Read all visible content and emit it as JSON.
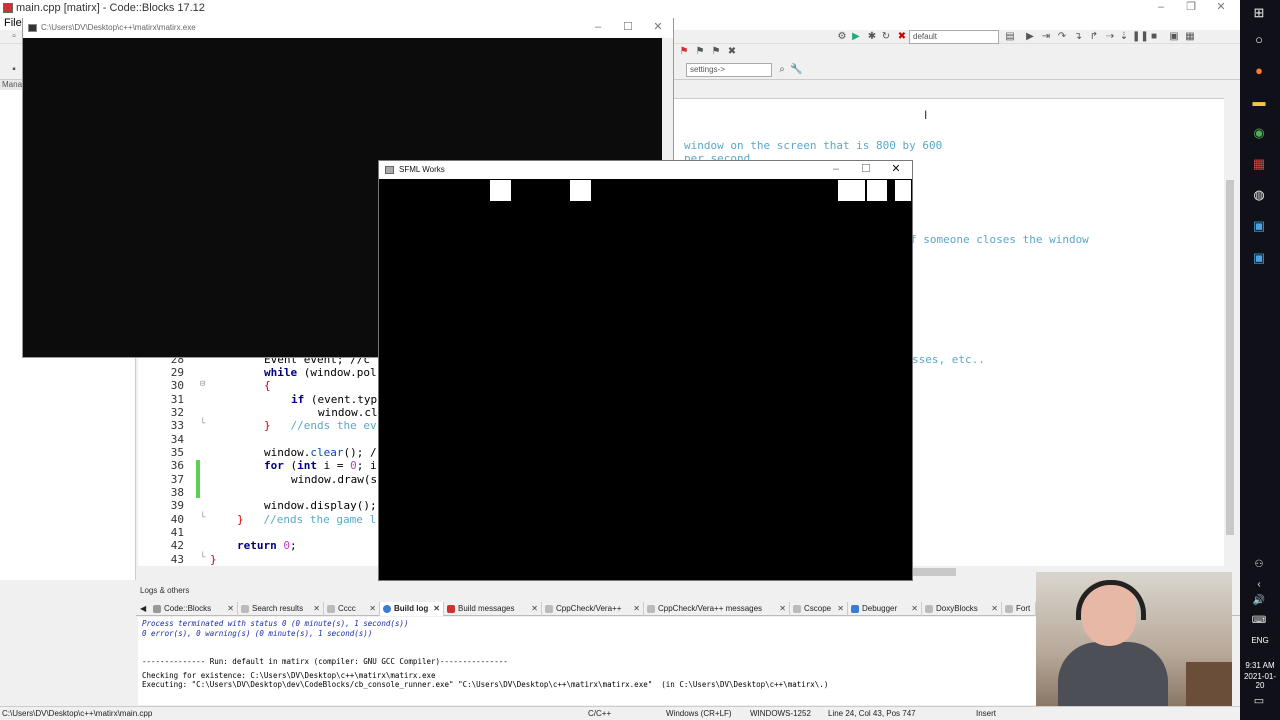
{
  "codeblocks": {
    "title": "main.cpp [matirx] - Code::Blocks 17.12",
    "menu_first": "File",
    "build_target": "default",
    "settings_combo": "settings->",
    "management_label": "Manag"
  },
  "console": {
    "title": "C:\\Users\\DV\\Desktop\\c++\\matirx\\matirx.exe"
  },
  "sfml": {
    "title": "SFML Works"
  },
  "editor": {
    "line_numbers": [
      "28",
      "29",
      "30",
      "31",
      "32",
      "33",
      "34",
      "35",
      "36",
      "37",
      "38",
      "39",
      "40",
      "41",
      "42",
      "43"
    ],
    "visible_comment_1": "window on the screen that is 800 by 600",
    "visible_comment_2": "per second",
    "visible_comment_3": "f someone closes the window",
    "visible_comment_4": "sses, etc..",
    "line28": "Event event; //c",
    "line29_kw": "while",
    "line29_rest": " (window.pol",
    "line30": "{",
    "line31_kw": "if",
    "line31_rest": " (event.typ",
    "line32": "window.cl",
    "line33_brace": "}",
    "line33_cm": "//ends the ev",
    "line35_a": "window.",
    "line35_fn": "clear",
    "line35_b": "(); /",
    "line36_kw": "for",
    "line36_a": " (",
    "line36_kw2": "int",
    "line36_b": " i = ",
    "line36_num": "0",
    "line36_c": "; i",
    "line37": "window.draw(s",
    "line39_a": "window.display();",
    "line40_brace": "}",
    "line40_cm": "//ends the game l",
    "line42_kw": "return",
    "line42_num": "0",
    "line42_rest": ";",
    "line43": "}"
  },
  "logs": {
    "header": "Logs & others",
    "tabs": [
      {
        "label": "Code::Blocks"
      },
      {
        "label": "Search results"
      },
      {
        "label": "Cccc"
      },
      {
        "label": "Build log"
      },
      {
        "label": "Build messages"
      },
      {
        "label": "CppCheck/Vera++"
      },
      {
        "label": "CppCheck/Vera++ messages"
      },
      {
        "label": "Cscope"
      },
      {
        "label": "Debugger"
      },
      {
        "label": "DoxyBlocks"
      },
      {
        "label": "Fort"
      }
    ],
    "lines": [
      "Process terminated with status 0 (0 minute(s), 1 second(s))",
      "0 error(s), 0 warning(s) (0 minute(s), 1 second(s))",
      "",
      "-------------- Run: default in matirx (compiler: GNU GCC Compiler)---------------",
      "Checking for existence: C:\\Users\\DV\\Desktop\\c++\\matirx\\matirx.exe",
      "Executing: \"C:\\Users\\DV\\Desktop\\dev\\CodeBlocks/cb_console_runner.exe\" \"C:\\Users\\DV\\Desktop\\c++\\matirx\\matirx.exe\"  (in C:\\Users\\DV\\Desktop\\c++\\matirx\\.)"
    ]
  },
  "status": {
    "path": "C:\\Users\\DV\\Desktop\\c++\\matirx\\main.cpp",
    "language": "C/C++",
    "eol": "Windows (CR+LF)",
    "encoding": "WINDOWS-1252",
    "position": "Line 24, Col 43, Pos 747",
    "mode": "Insert"
  },
  "taskbar": {
    "lang": "ENG",
    "time": "9:31 AM",
    "date": "2021-01-20"
  }
}
